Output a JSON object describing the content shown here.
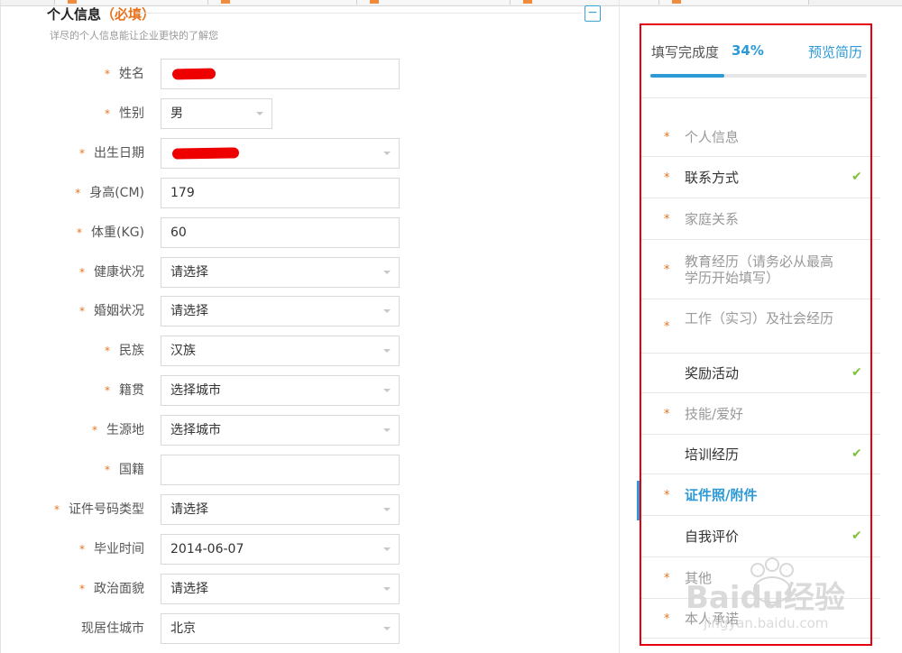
{
  "section": {
    "title": "个人信息",
    "required_tag": "（必填）",
    "subtitle": "详尽的个人信息能让企业更快的了解您",
    "collapse_glyph": "−"
  },
  "form": {
    "fields": [
      {
        "label": "姓名",
        "required": true,
        "value": "",
        "type": "text",
        "redacted": true
      },
      {
        "label": "性别",
        "required": true,
        "value": "男",
        "type": "select-narrow"
      },
      {
        "label": "出生日期",
        "required": true,
        "value": "",
        "type": "select",
        "redacted": true
      },
      {
        "label": "身高(CM)",
        "required": true,
        "value": "179",
        "type": "text"
      },
      {
        "label": "体重(KG)",
        "required": true,
        "value": "60",
        "type": "text"
      },
      {
        "label": "健康状况",
        "required": true,
        "value": "请选择",
        "type": "select"
      },
      {
        "label": "婚姻状况",
        "required": true,
        "value": "请选择",
        "type": "select"
      },
      {
        "label": "民族",
        "required": true,
        "value": "汉族",
        "type": "select"
      },
      {
        "label": "籍贯",
        "required": true,
        "value": "选择城市",
        "type": "select"
      },
      {
        "label": "生源地",
        "required": true,
        "value": "选择城市",
        "type": "select"
      },
      {
        "label": "国籍",
        "required": true,
        "value": "",
        "type": "text"
      },
      {
        "label": "证件号码类型",
        "required": true,
        "value": "请选择",
        "type": "select"
      },
      {
        "label": "毕业时间",
        "required": true,
        "value": "2014-06-07",
        "type": "select"
      },
      {
        "label": "政治面貌",
        "required": true,
        "value": "请选择",
        "type": "select"
      },
      {
        "label": "现居住城市",
        "required": false,
        "value": "北京",
        "type": "select"
      }
    ]
  },
  "sidebar": {
    "progress_label": "填写完成度",
    "progress_percent_text": "34%",
    "progress_fraction": 0.34,
    "preview_label": "预览简历",
    "items": [
      {
        "label": "个人信息",
        "required": true,
        "done": false,
        "active": false
      },
      {
        "label": "联系方式",
        "required": true,
        "done": true,
        "active": false
      },
      {
        "label": "家庭关系",
        "required": true,
        "done": false,
        "active": false
      },
      {
        "label": "教育经历（请务必从最高学历开始填写）",
        "required": true,
        "done": false,
        "active": false
      },
      {
        "label": "工作（实习）及社会经历",
        "required": true,
        "done": false,
        "active": false
      },
      {
        "label": "奖励活动",
        "required": false,
        "done": true,
        "active": false
      },
      {
        "label": "技能/爱好",
        "required": true,
        "done": false,
        "active": false
      },
      {
        "label": "培训经历",
        "required": false,
        "done": true,
        "active": false
      },
      {
        "label": "证件照/附件",
        "required": true,
        "done": false,
        "active": true
      },
      {
        "label": "自我评价",
        "required": false,
        "done": true,
        "active": false
      },
      {
        "label": "其他",
        "required": true,
        "done": false,
        "active": false
      },
      {
        "label": "本人承诺",
        "required": true,
        "done": false,
        "active": false
      }
    ]
  },
  "watermark": {
    "brand": "Baidu经验",
    "url": "jingyan.baidu.com"
  },
  "colors": {
    "accent": "#2d9ad6",
    "required": "#e8731d",
    "check": "#7ec13a",
    "highlight": "#e60012"
  }
}
